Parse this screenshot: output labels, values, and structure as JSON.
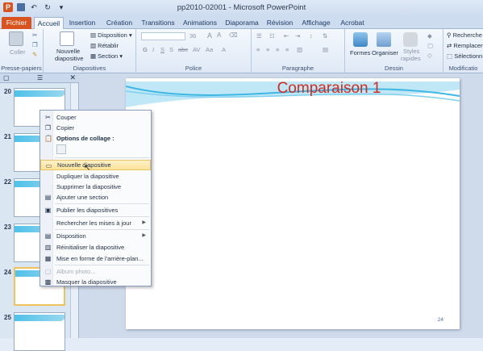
{
  "window": {
    "title": "pp2010-02001 - Microsoft PowerPoint"
  },
  "tabs": [
    "Fichier",
    "Accueil",
    "Insertion",
    "Création",
    "Transitions",
    "Animations",
    "Diaporama",
    "Révision",
    "Affichage",
    "Acrobat"
  ],
  "ribbon": {
    "clipboard": {
      "paste": "Coller",
      "label": "Presse-papiers"
    },
    "slides": {
      "new_slide_1": "Nouvelle",
      "new_slide_2": "diapositive",
      "layout": "Disposition",
      "reset": "Rétablir",
      "section": "Section",
      "label": "Diapositives"
    },
    "font": {
      "size": "36",
      "label": "Police"
    },
    "paragraph": {
      "label": "Paragraphe"
    },
    "drawing": {
      "shapes": "Formes",
      "arrange": "Organiser",
      "styles_1": "Styles",
      "styles_2": "rapides",
      "label": "Dessin"
    },
    "editing": {
      "find": "Recherche",
      "replace": "Remplacer",
      "select": "Sélectionn",
      "label": "Modificatio"
    }
  },
  "thumbnails": {
    "numbers": [
      "20",
      "21",
      "22",
      "23",
      "24",
      "25"
    ],
    "selected": "24"
  },
  "slide": {
    "title": "Comparaison 1",
    "number": "24"
  },
  "context_menu": {
    "cut": "Couper",
    "copy": "Copier",
    "paste_options": "Options de collage :",
    "new_slide": "Nouvelle diapositive",
    "duplicate": "Dupliquer la diapositive",
    "delete": "Supprimer la diapositive",
    "add_section": "Ajouter une section",
    "publish": "Publier les diapositives",
    "check_updates": "Rechercher les mises à jour",
    "layout": "Disposition",
    "reset": "Réinitialiser la diapositive",
    "format_bg": "Mise en forme de l'arrière-plan...",
    "photo_album": "Album photo...",
    "hide": "Masquer la diapositive"
  },
  "colors": {
    "file_tab": "#d9531e",
    "title_red": "#d52b1e",
    "highlight": "#fbe39a"
  }
}
